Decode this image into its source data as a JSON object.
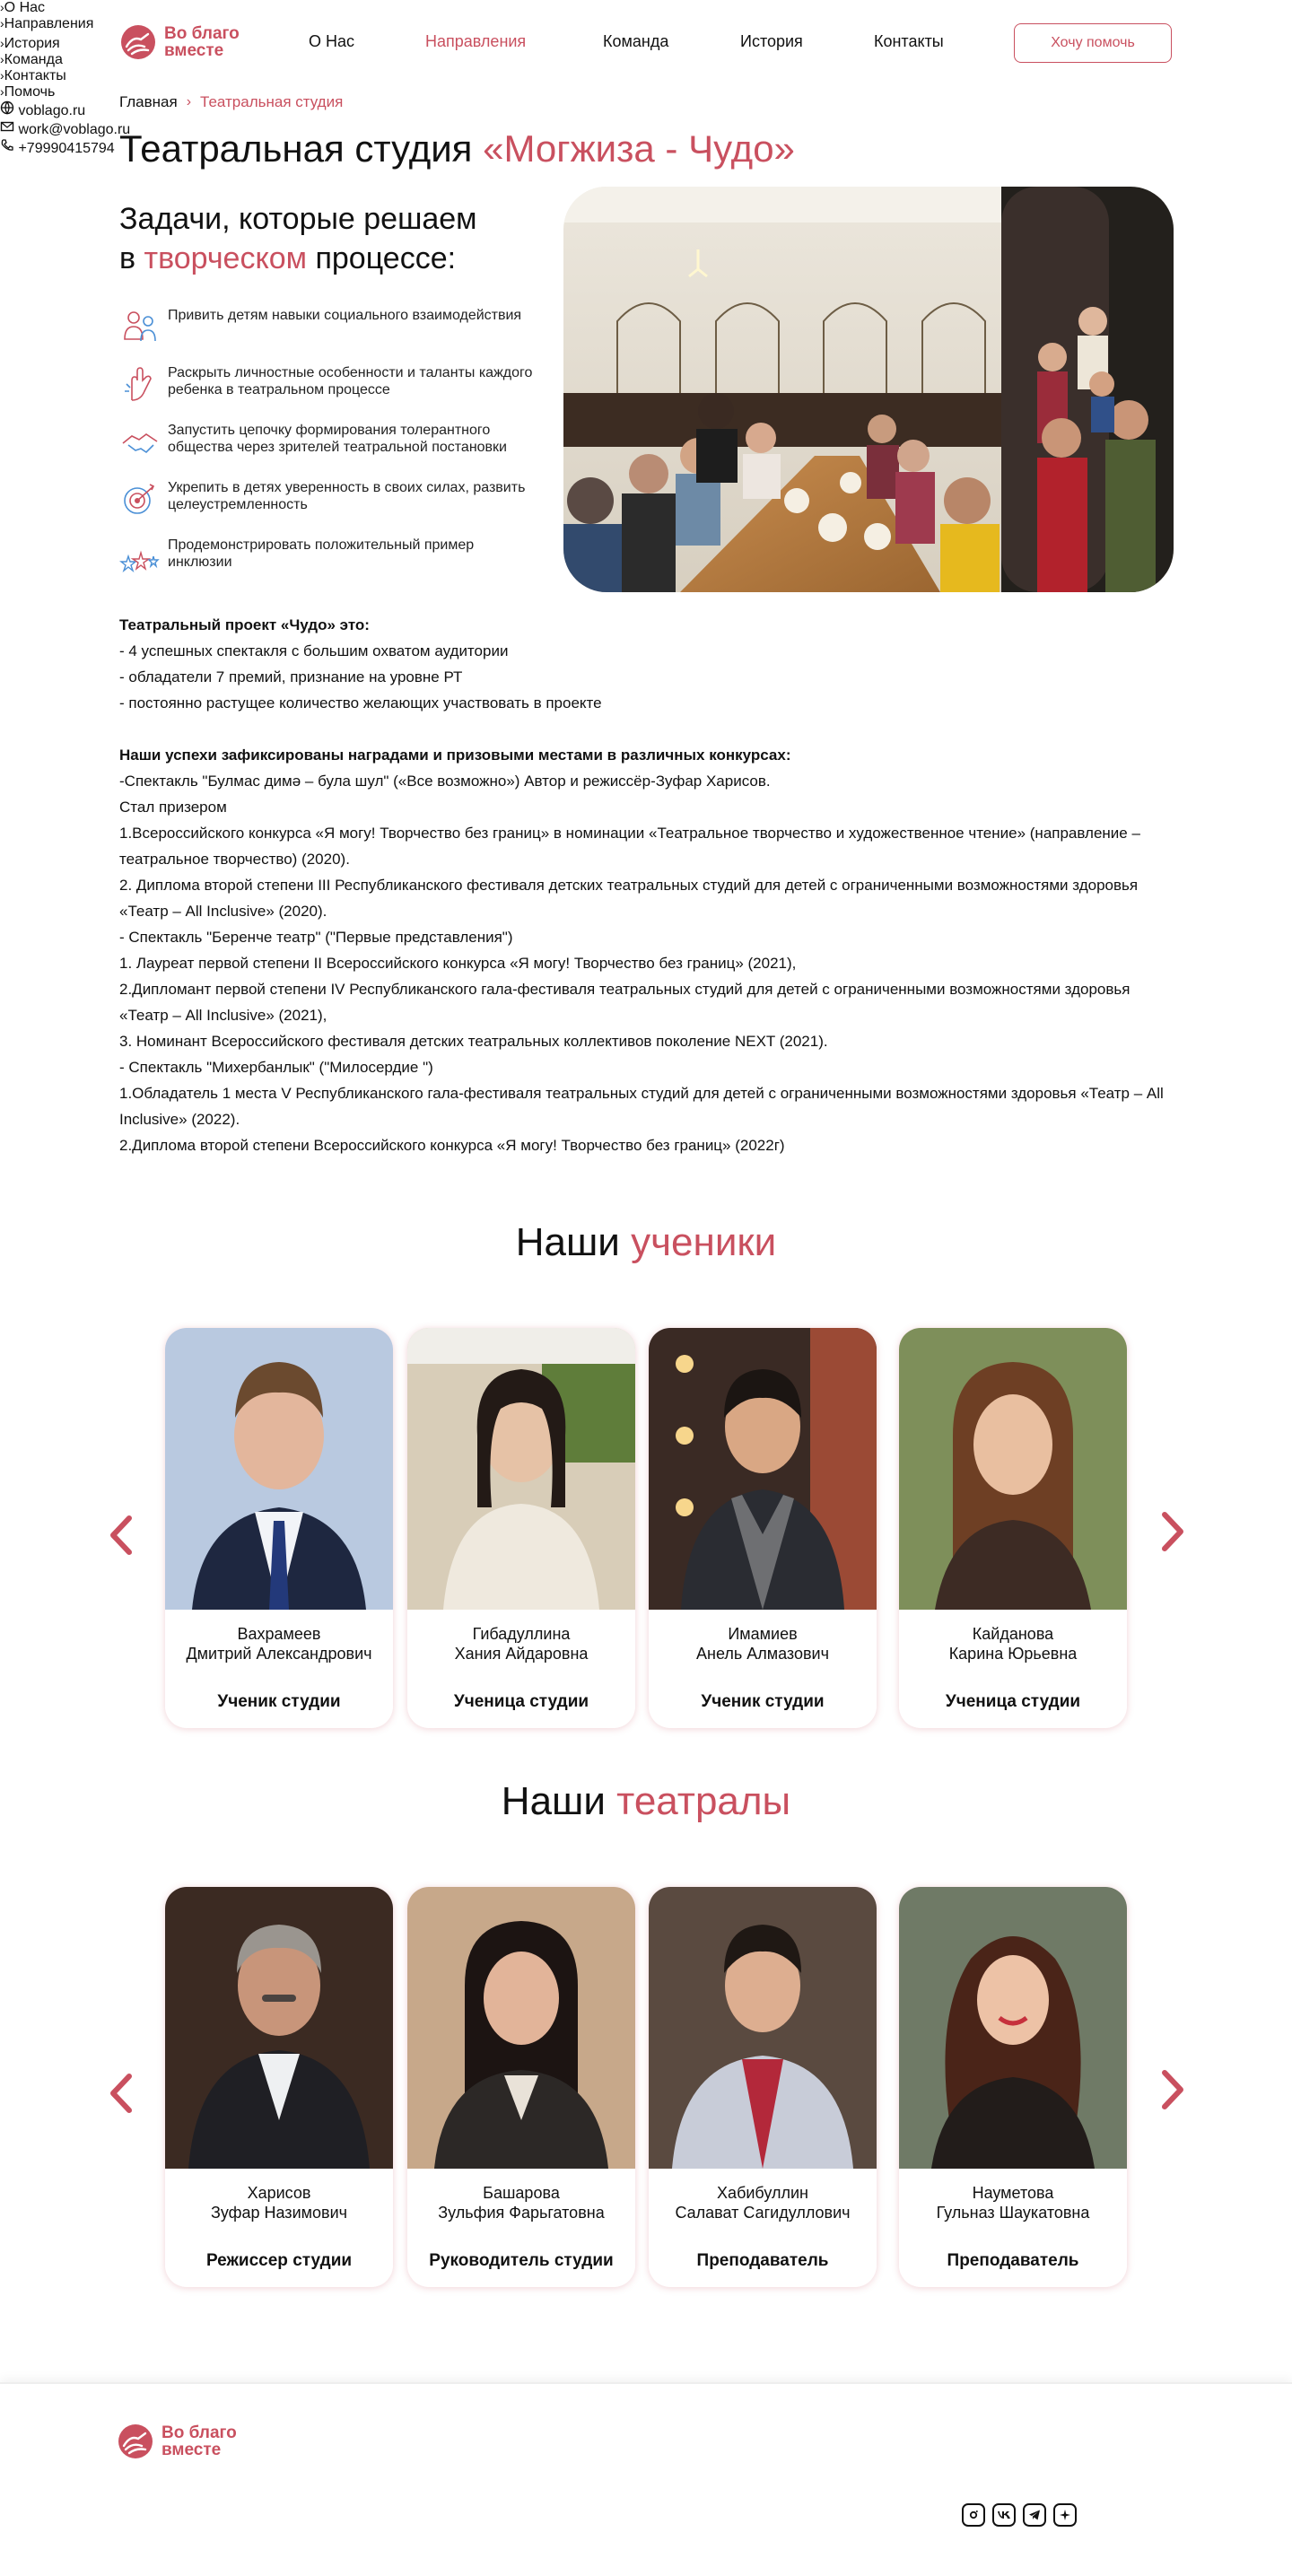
{
  "header": {
    "logo_line1": "Во благо",
    "logo_line2": "вместе",
    "nav": [
      "О Нас",
      "Направления",
      "Команда",
      "История",
      "Контакты"
    ],
    "help_button": "Хочу помочь"
  },
  "breadcrumb": {
    "home": "Главная",
    "current": "Театральная студия"
  },
  "title": {
    "prefix": "Театральная студия ",
    "highlight": "«Могжиза - Чудо»"
  },
  "tasks": {
    "title_line1": "Задачи, которые решаем",
    "title_pre": "в ",
    "title_highlight": "творческом",
    "title_post": " процессе:",
    "items": [
      {
        "icon": "people-icon",
        "text": "Привить детям навыки социального взаимодействия"
      },
      {
        "icon": "hand-icon",
        "text": "Раскрыть личностные особенности и таланты каждого ребенка в театральном процессе"
      },
      {
        "icon": "handshake-icon",
        "text": "Запустить цепочку формирования толерантного общества через зрителей театральной постановки"
      },
      {
        "icon": "target-icon",
        "text": "Укрепить в детях уверенность в своих силах, развить целеустремленность"
      },
      {
        "icon": "stars-icon",
        "text": "Продемонстрировать положительный пример инклюзии"
      }
    ]
  },
  "project": {
    "heading": "Театральный проект «Чудо» это:",
    "points": [
      "- 4 успешных спектакля с большим охватом аудитории",
      "- обладатели 7 премий, признание на уровне РТ",
      "- постоянно растущее количество желающих участвовать в проекте"
    ],
    "awards_heading": "Наши успехи зафиксированы наградами и призовыми местами в различных конкурсах:",
    "awards": [
      "-Спектакль \"Булмас димә – була шул\" («Все возможно») Автор и режиссёр-Зуфар Харисов.",
      "Стал призером",
      "1.Всероссийского конкурса «Я могу! Творчество без границ» в номинации «Театральное творчество и художественное чтение» (направление – театральное творчество) (2020).",
      "2. Диплома второй степени III Республиканского фестиваля детских театральных студий для детей с ограниченными возможностями здоровья «Театр – All Inclusive» (2020).",
      "- Спектакль \"Беренче театр\" (\"Первые представления\")",
      "1. Лауреат первой степени II Всероссийского конкурса «Я могу! Творчество без границ» (2021),",
      "2.Дипломант первой степени IV Республиканского гала-фестиваля театральных студий для детей с ограниченными возможностями здоровья «Театр – All Inclusive» (2021),",
      "3. Номинант Всероссийского фестиваля детских театральных коллективов поколение NEXT (2021).",
      "- Спектакль \"Михербанлык\" (\"Милосердие \")",
      "1.Обладатель 1 места V Республиканского гала-фестиваля театральных студий для детей с ограниченными возможностями здоровья «Театр – All Inclusive» (2022).",
      "2.Диплома второй степени Всероссийского конкурса «Я могу! Творчество без границ» (2022г)"
    ]
  },
  "students": {
    "title_pre": "Наши ",
    "title_highlight": "ученики",
    "cards": [
      {
        "surname": "Вахрамеев",
        "name": "Дмитрий Александрович",
        "role": "Ученик студии"
      },
      {
        "surname": "Гибадуллина",
        "name": "Хания Айдаровна",
        "role": "Ученица студии"
      },
      {
        "surname": "Имамиев",
        "name": "Анель Алмазович",
        "role": "Ученик студии"
      },
      {
        "surname": "Кайданова",
        "name": "Карина Юрьевна",
        "role": "Ученица студии"
      }
    ]
  },
  "teachers": {
    "title_pre": "Наши ",
    "title_highlight": "театралы",
    "cards": [
      {
        "surname": "Харисов",
        "name": "Зуфар Назимович",
        "role": "Режиссер студии"
      },
      {
        "surname": "Башарова",
        "name": "Зульфия Фарьгатовна",
        "role": "Руководитель студии"
      },
      {
        "surname": "Хабибуллин",
        "name": "Салават Сагидуллович",
        "role": "Преподаватель"
      },
      {
        "surname": "Науметова",
        "name": "Гульназ Шаукатовна",
        "role": "Преподаватель"
      }
    ]
  },
  "footer": {
    "col1": [
      "О Нас",
      "Направления",
      "История"
    ],
    "col2": [
      "Команда",
      "Контакты",
      "Помочь"
    ],
    "site": "voblago.ru",
    "email": "work@voblago.ru",
    "phone": "+79990415794",
    "socials": [
      "instagram-icon",
      "vk-icon",
      "telegram-icon",
      "plus-icon"
    ]
  },
  "colors": {
    "accent": "#c9505f"
  }
}
